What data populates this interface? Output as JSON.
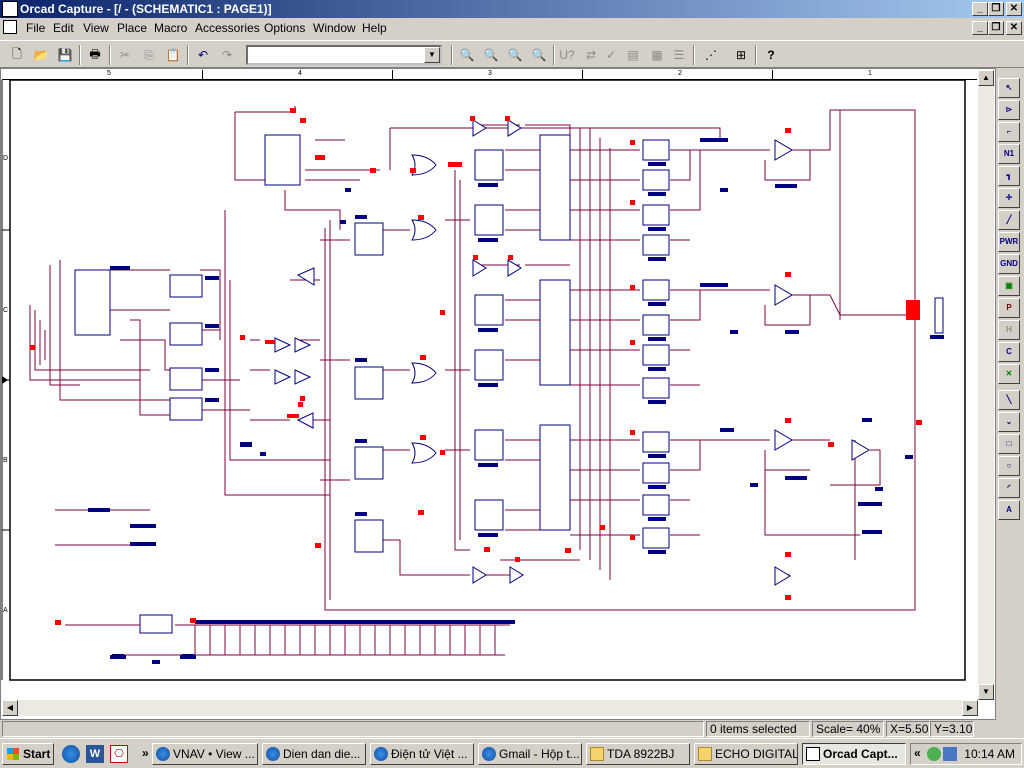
{
  "window": {
    "title": "Orcad Capture - [/ - (SCHEMATIC1 : PAGE1)]"
  },
  "menu": [
    "File",
    "Edit",
    "View",
    "Place",
    "Macro",
    "Accessories",
    "Options",
    "Window",
    "Help"
  ],
  "toolbar": {
    "part_combo_value": ""
  },
  "ruler": {
    "labels": [
      "5",
      "4",
      "3",
      "2",
      "1"
    ]
  },
  "side_ruler": {
    "labels": [
      "D",
      "C",
      "B",
      "A"
    ]
  },
  "palette": [
    "select",
    "place-part",
    "place-wire",
    "place-net-alias",
    "place-bus",
    "place-junction",
    "place-bus-entry",
    "place-power",
    "place-ground",
    "place-hierarchical-block",
    "place-port",
    "place-pin",
    "place-off-page",
    "place-no-connect",
    "place-line",
    "place-polyline",
    "place-rectangle",
    "place-ellipse",
    "place-arc",
    "place-text"
  ],
  "palette_labels": {
    "net_alias": "N1",
    "power": "PWR",
    "ground": "GND",
    "port": "P",
    "pin": "H",
    "off_page": "C",
    "text": "A"
  },
  "status": {
    "selection": "0 items selected",
    "scale": "Scale= 40%",
    "x": "X=5.50",
    "y": "Y=3.10"
  },
  "taskbar": {
    "start": "Start",
    "overflow": "»",
    "tasks": [
      {
        "label": "VNAV • View ...",
        "icon": "browser-icon"
      },
      {
        "label": "Dien dan die...",
        "icon": "browser-icon"
      },
      {
        "label": "Điện tử Việt ...",
        "icon": "browser-icon"
      },
      {
        "label": "Gmail - Hộp t...",
        "icon": "browser-icon"
      },
      {
        "label": "TDA 8922BJ",
        "icon": "folder-icon"
      },
      {
        "label": "ECHO DIGITAL",
        "icon": "folder-icon"
      },
      {
        "label": "Orcad Capt...",
        "icon": "orcad-icon"
      }
    ],
    "tray_overflow": "«",
    "clock": "10:14 AM"
  },
  "colors": {
    "wire": "#800040",
    "part": "#000080",
    "pin_marker": "#ff0000",
    "title_start": "#0a246a",
    "title_end": "#a6caf0"
  }
}
